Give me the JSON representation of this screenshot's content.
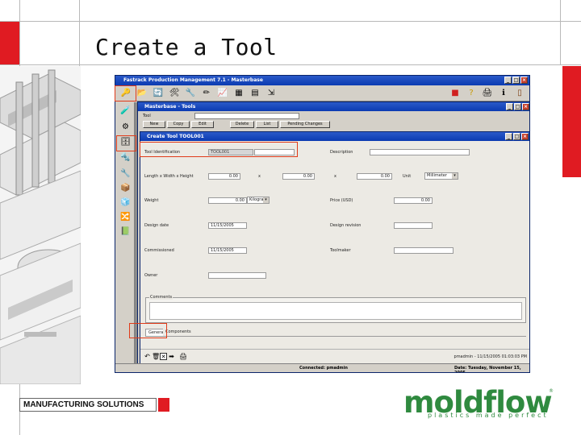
{
  "slide": {
    "title": "Create a Tool",
    "footer_label": "MANUFACTURING SOLUTIONS",
    "logo_word": "moldflow",
    "logo_tagline": "plastics made perfect",
    "logo_reg": "®",
    "accent_red": "#e01b22",
    "logo_green": "#2f8a3f"
  },
  "app": {
    "title": "Fastrack Production Management 7.1 - Masterbase",
    "window_buttons": [
      "_",
      "□",
      "×"
    ],
    "toolbar_icons": [
      "login-icon",
      "open-icon",
      "refresh-icon",
      "tools-icon",
      "wrench-icon",
      "pencil-icon",
      "chart-icon",
      "grid-icon",
      "calculator-icon",
      "export-icon",
      "toolbox-icon",
      "help-icon",
      "print-icon",
      "exit-icon"
    ],
    "leftbar_icons": [
      "materials-icon",
      "machines-icon",
      "tools-icon",
      "molds-icon",
      "parts-icon",
      "inventory-icon",
      "cube-icon",
      "routing-icon",
      "reports-icon"
    ],
    "status": {
      "connected": "Connected: pmadmin",
      "date": "Date: Tuesday, November 15, 2005"
    }
  },
  "masterbase": {
    "title": "Masterbase - Tools",
    "tool_label": "Tool",
    "buttons": [
      "New",
      "Copy",
      "Edit",
      "Delete",
      "List",
      "Pending Changes"
    ]
  },
  "create_tool": {
    "title": "Create Tool TOOL001",
    "fields": {
      "tool_id_label": "Tool Identification",
      "tool_id_value": "TOOL001",
      "description_label": "Description",
      "lwh_label": "Length x Width x Height",
      "length_value": "0.00",
      "width_value": "0.00",
      "height_value": "0.00",
      "x_symbol": "x",
      "unit_label": "Unit",
      "unit_value": "Millimeter",
      "weight_label": "Weight",
      "weight_value": "0.00",
      "weight_unit": "Kilogram",
      "price_label": "Price (USD)",
      "price_value": "0.00",
      "design_date_label": "Design date",
      "design_date_value": "11/15/2005",
      "design_revision_label": "Design revision",
      "commissioned_label": "Commissioned",
      "commissioned_value": "11/15/2005",
      "toolmaker_label": "Toolmaker",
      "owner_label": "Owner",
      "comments_label": "Comments"
    },
    "tabs": [
      "General",
      "Components"
    ],
    "bottom_status": "pmadmin - 11/15/2005 01:03:03 PM"
  }
}
